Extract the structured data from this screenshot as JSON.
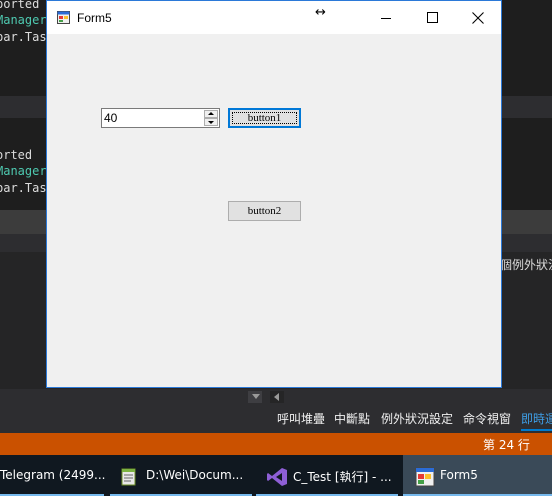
{
  "ide": {
    "code_top": [
      {
        "text": "ported",
        "color": "white"
      },
      {
        "text": "Manager",
        "color": "teal"
      },
      {
        "text": "bar.Tas",
        "color": "white"
      }
    ],
    "code_bottom": [
      {
        "text": "orted",
        "color": "white"
      },
      {
        "text": "Manager",
        "color": "teal"
      },
      {
        "text": "bar.Tas",
        "color": "white"
      }
    ],
    "exception_column_text": "個例外狀況",
    "tool_tabs": [
      "呼叫堆疊",
      "中斷點",
      "例外狀況設定",
      "命令視窗",
      "即時運"
    ],
    "active_tab_index": 4,
    "status_line": "第 24 行",
    "colors": {
      "status_bar": "#ca5100",
      "accent": "#007acc"
    }
  },
  "form": {
    "title": "Form5",
    "numeric_value": "40",
    "button1_label": "button1",
    "button2_label": "button2"
  },
  "taskbar": {
    "items": [
      {
        "label": "Telegram (2499...",
        "icon": "telegram-icon"
      },
      {
        "label": "D:\\Wei\\Docum...",
        "icon": "notepad-icon"
      },
      {
        "label": "C_Test [執行] - ...",
        "icon": "visual-studio-icon"
      },
      {
        "label": "Form5",
        "icon": "form-app-icon"
      }
    ]
  }
}
